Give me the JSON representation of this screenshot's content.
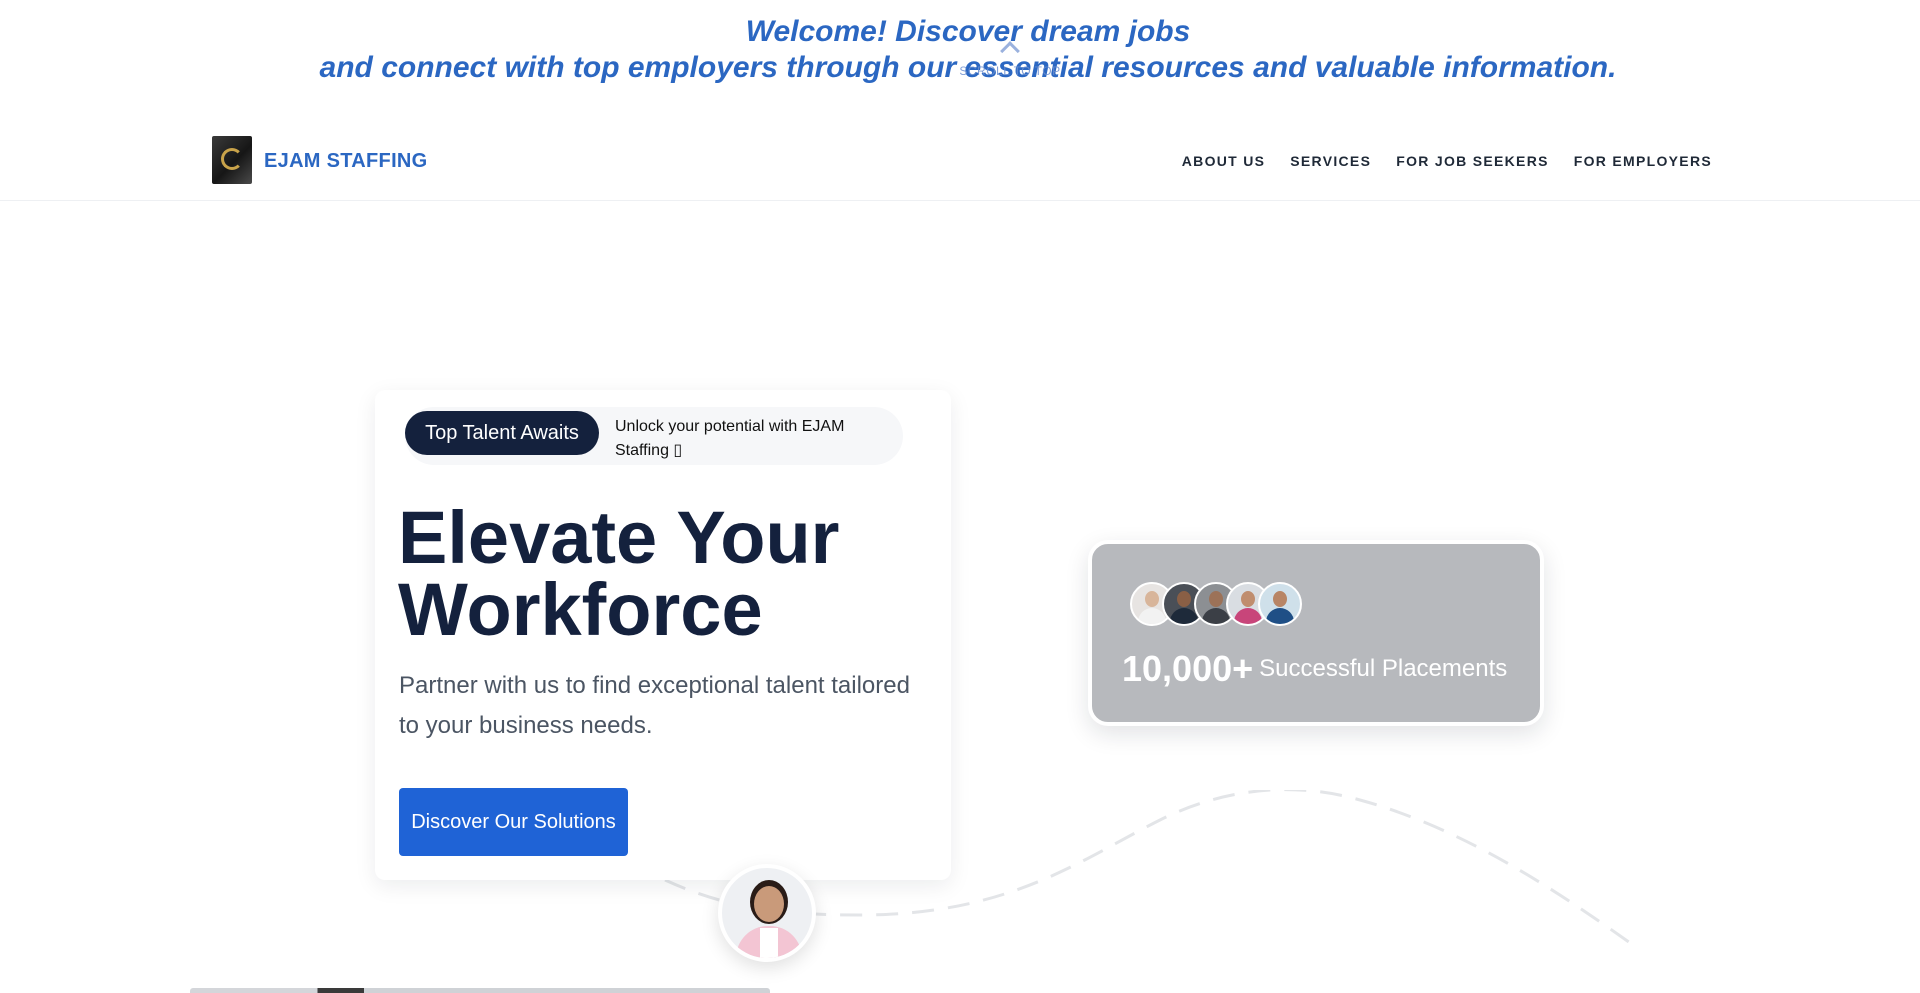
{
  "banner": {
    "line1": "Welcome! Discover dream jobs",
    "line2": "and connect with top employers through our essential resources and valuable information.",
    "scroll_top_label": "SCROLL TO TOP"
  },
  "header": {
    "brand": "EJAM STAFFING",
    "nav": [
      "ABOUT US",
      "SERVICES",
      "FOR JOB SEEKERS",
      "FOR EMPLOYERS"
    ]
  },
  "hero": {
    "badge": "Top Talent Awaits",
    "badge_text": "Unlock your potential with EJAM Staffing ▯",
    "title_line1": "Elevate Your",
    "title_line2": "Workforce",
    "subtitle": "Partner with us to find exceptional talent tailored to your business needs.",
    "cta": "Discover Our Solutions"
  },
  "stats": {
    "number": "10,000+",
    "label": "Successful Placements"
  },
  "colors": {
    "brand_blue": "#2b67c2",
    "navy": "#14213d",
    "cta_blue": "#1f63d6",
    "stats_card": "#b7b9bd"
  },
  "icons": [
    "chevron-up-icon",
    "logo-icon"
  ]
}
